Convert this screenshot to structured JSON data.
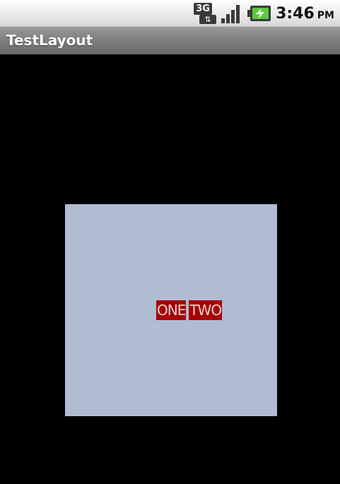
{
  "status_bar": {
    "network_type": "3G",
    "data_arrows": "⇅",
    "signal_level": 4,
    "signal_max": 4,
    "battery_state": "charging",
    "time": "3:46",
    "ampm": "PM"
  },
  "title_bar": {
    "title": "TestLayout"
  },
  "content": {
    "box_color": "#b0bcd2",
    "label_one": "ONE",
    "label_two": "TWO",
    "label_bg": "#a80000"
  }
}
